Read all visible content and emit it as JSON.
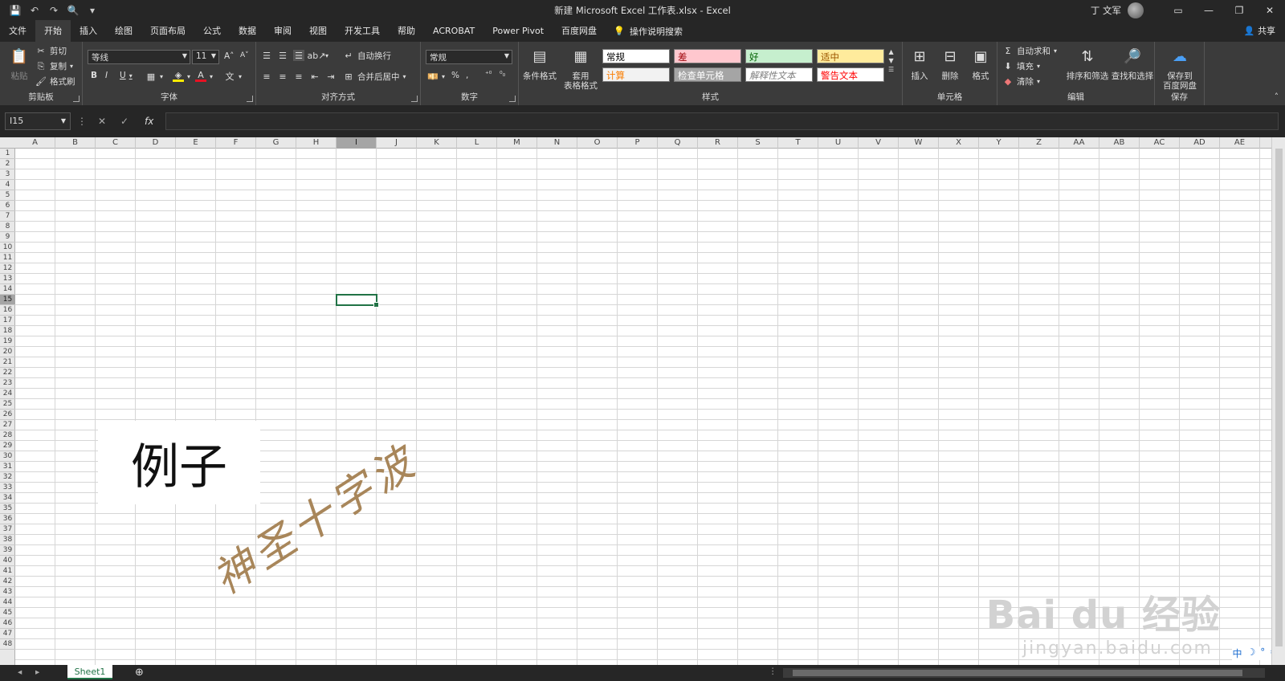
{
  "titlebar": {
    "title": "新建 Microsoft Excel 工作表.xlsx  -  Excel",
    "user": "丁 文军"
  },
  "tabs": [
    "文件",
    "开始",
    "插入",
    "绘图",
    "页面布局",
    "公式",
    "数据",
    "审阅",
    "视图",
    "开发工具",
    "帮助",
    "ACROBAT",
    "Power Pivot",
    "百度网盘"
  ],
  "tellme": "操作说明搜索",
  "share": "共享",
  "ribbon": {
    "clipboard": {
      "paste": "粘贴",
      "cut": "剪切",
      "copy": "复制",
      "format_painter": "格式刷",
      "label": "剪贴板"
    },
    "font": {
      "name": "等线",
      "size": "11",
      "label": "字体",
      "bold": "B",
      "italic": "I",
      "underline": "U"
    },
    "alignment": {
      "wrap": "自动换行",
      "merge": "合并后居中",
      "label": "对齐方式"
    },
    "number": {
      "format": "常规",
      "percent": "%",
      "comma": ",",
      "label": "数字"
    },
    "styles": {
      "conditional": "条件格式",
      "table_l1": "套用",
      "table_l2": "表格格式",
      "label": "样式",
      "items": [
        {
          "text": "常规",
          "bg": "#ffffff",
          "fg": "#000000"
        },
        {
          "text": "差",
          "bg": "#ffc7ce",
          "fg": "#9c0006"
        },
        {
          "text": "好",
          "bg": "#c6efce",
          "fg": "#006100"
        },
        {
          "text": "适中",
          "bg": "#ffeb9c",
          "fg": "#9c5700"
        },
        {
          "text": "计算",
          "bg": "#f2f2f2",
          "fg": "#fa7d00"
        },
        {
          "text": "检查单元格",
          "bg": "#a5a5a5",
          "fg": "#ffffff"
        },
        {
          "text": "解释性文本",
          "bg": "#ffffff",
          "fg": "#7f7f7f"
        },
        {
          "text": "警告文本",
          "bg": "#ffffff",
          "fg": "#ff0000"
        }
      ]
    },
    "cells": {
      "insert": "插入",
      "delete": "删除",
      "format": "格式",
      "label": "单元格"
    },
    "editing": {
      "autosum": "自动求和",
      "fill": "填充",
      "clear": "清除",
      "sort": "排序和筛选",
      "find": "查找和选择",
      "label": "编辑"
    },
    "save": {
      "line1": "保存到",
      "line2": "百度网盘",
      "label": "保存"
    }
  },
  "formula_bar": {
    "name_box": "I15",
    "fx": "fx",
    "value": ""
  },
  "columns": [
    "A",
    "B",
    "C",
    "D",
    "E",
    "F",
    "G",
    "H",
    "I",
    "J",
    "K",
    "L",
    "M",
    "N",
    "O",
    "P",
    "Q",
    "R",
    "S",
    "T",
    "U",
    "V",
    "W",
    "X",
    "Y",
    "Z",
    "AA",
    "AB",
    "AC",
    "AD",
    "AE"
  ],
  "rows": [
    "1",
    "2",
    "3",
    "4",
    "5",
    "6",
    "7",
    "8",
    "9",
    "10",
    "11",
    "12",
    "13",
    "14",
    "15",
    "16",
    "17",
    "18",
    "19",
    "20",
    "21",
    "22",
    "23",
    "24",
    "25",
    "26",
    "27",
    "28",
    "29",
    "30",
    "31",
    "32",
    "33",
    "34",
    "35",
    "36",
    "37",
    "38",
    "39",
    "40",
    "41",
    "42",
    "43",
    "44",
    "45",
    "46",
    "47",
    "48"
  ],
  "selected": {
    "column": "I",
    "row": "15"
  },
  "content": {
    "example_text": "例子",
    "watermark_text": "神圣十字波"
  },
  "baidu": {
    "brand": "Bai du 经验",
    "url": "jingyan.baidu.com"
  },
  "ime": [
    "中",
    "☽",
    "°",
    "⚙"
  ],
  "sheets": [
    "Sheet1"
  ]
}
